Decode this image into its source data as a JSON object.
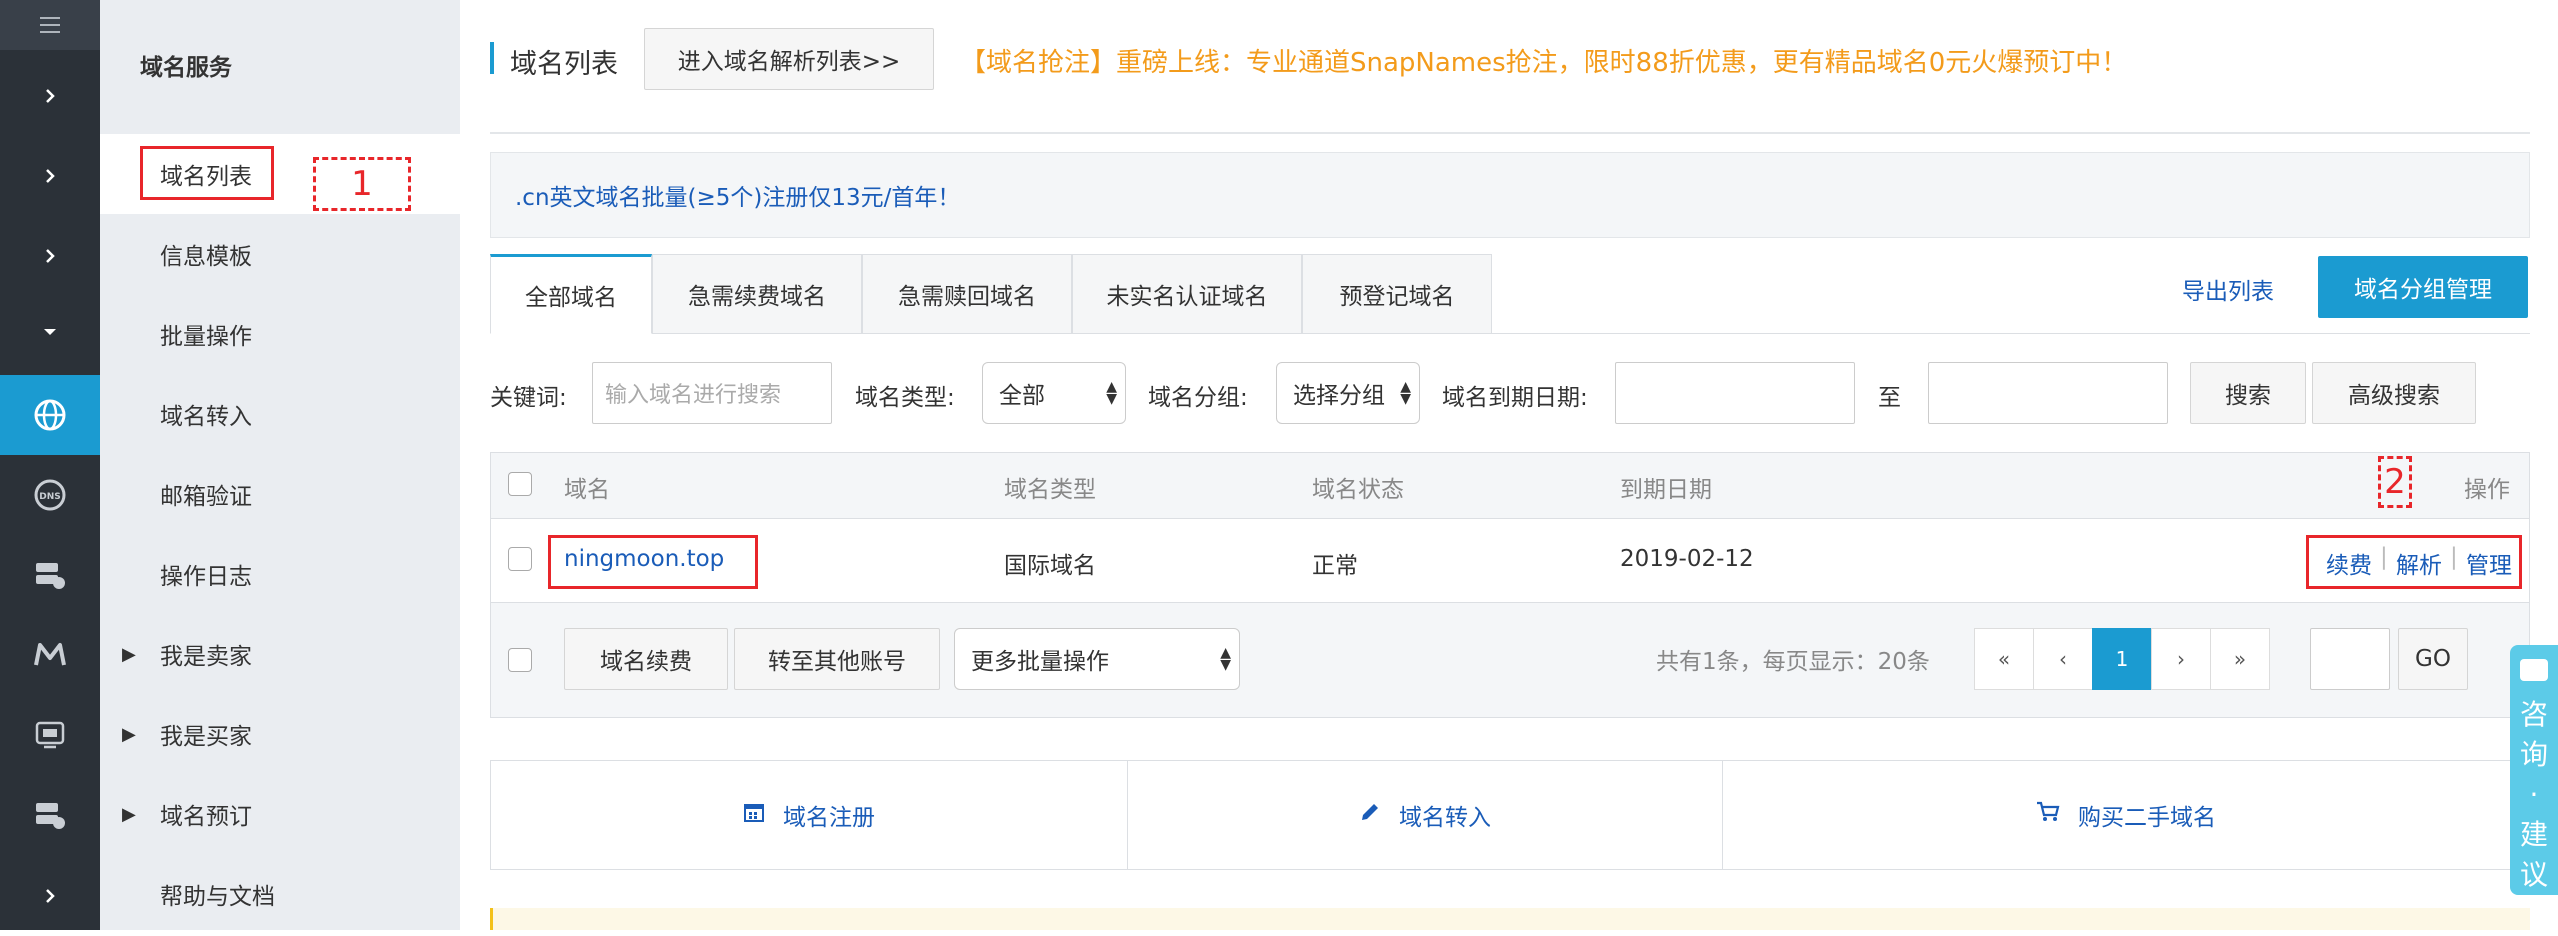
{
  "sidebar_rail": {
    "items": [
      "menu-icon",
      "chevron-right-icon",
      "chevron-right-icon",
      "chevron-right-icon",
      "chevron-down-icon",
      "globe-icon",
      "dns-icon",
      "server-icon",
      "m-logo-icon",
      "monitor-icon",
      "server-icon",
      "chevron-right-icon"
    ],
    "active_color": "#1b9bd1"
  },
  "sidemenu": {
    "title": "域名服务",
    "items": [
      {
        "label": "域名列表"
      },
      {
        "label": "信息模板"
      },
      {
        "label": "批量操作"
      },
      {
        "label": "域名转入"
      },
      {
        "label": "邮箱验证"
      },
      {
        "label": "操作日志"
      },
      {
        "label": "我是卖家"
      },
      {
        "label": "我是买家"
      },
      {
        "label": "域名预订"
      },
      {
        "label": "帮助与文档"
      }
    ]
  },
  "annotations": {
    "box1": "1",
    "box2": "2"
  },
  "header": {
    "title": "域名列表",
    "dns_button": "进入域名解析列表>>",
    "promo": "【域名抢注】重磅上线：专业通道SnapNames抢注，限时88折优惠，更有精品域名0元火爆预订中！"
  },
  "notice": ".cn英文域名批量(≥5个)注册仅13元/首年！",
  "tabs": [
    "全部域名",
    "急需续费域名",
    "急需赎回域名",
    "未实名认证域名",
    "预登记域名"
  ],
  "actions": {
    "export": "导出列表",
    "group_manage": "域名分组管理"
  },
  "filters": {
    "keyword_label": "关键词:",
    "keyword_placeholder": "输入域名进行搜索",
    "type_label": "域名类型:",
    "type_value": "全部",
    "group_label": "域名分组:",
    "group_value": "选择分组",
    "expiry_label": "域名到期日期:",
    "to": "至",
    "search": "搜索",
    "advanced": "高级搜索"
  },
  "table": {
    "headers": [
      "域名",
      "域名类型",
      "域名状态",
      "到期日期",
      "操作"
    ],
    "rows": [
      {
        "domain": "ningmoon.top",
        "type": "国际域名",
        "status": "正常",
        "expiry": "2019-02-12",
        "ops": [
          "续费",
          "解析",
          "管理"
        ]
      }
    ]
  },
  "batch": {
    "renew": "域名续费",
    "transfer": "转至其他账号",
    "more": "更多批量操作",
    "summary": "共有1条，每页显示：20条",
    "pages": [
      "«",
      "‹",
      "1",
      "›",
      "»"
    ],
    "go": "GO"
  },
  "shortcuts": [
    {
      "label": "域名注册",
      "icon": "calendar-icon"
    },
    {
      "label": "域名转入",
      "icon": "pencil-icon"
    },
    {
      "label": "购买二手域名",
      "icon": "cart-icon"
    }
  ],
  "consult": {
    "chars": [
      "咨",
      "询",
      "·",
      "建",
      "议"
    ]
  },
  "colors": {
    "accent": "#1b9bd1",
    "promo": "#f39b1b",
    "link": "#1a5cb8",
    "annotation": "#e8262a"
  }
}
